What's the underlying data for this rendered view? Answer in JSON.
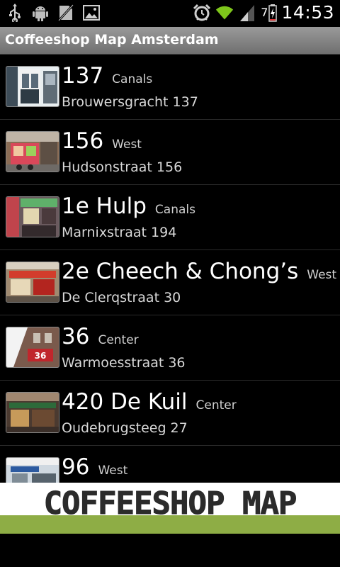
{
  "status_bar": {
    "time": "14:53",
    "battery_level": "7",
    "icons_left": [
      "usb-icon",
      "android-debug-icon",
      "no-sdcard-icon",
      "gallery-icon"
    ],
    "icons_right": [
      "alarm-icon",
      "wifi-icon",
      "signal-icon",
      "battery-charging-icon"
    ]
  },
  "app": {
    "title": "Coffeeshop Map Amsterdam"
  },
  "shops": [
    {
      "name": "137",
      "area": "Canals",
      "address": "Brouwersgracht 137"
    },
    {
      "name": "156",
      "area": "West",
      "address": "Hudsonstraat 156"
    },
    {
      "name": "1e Hulp",
      "area": "Canals",
      "address": "Marnixstraat 194"
    },
    {
      "name": "2e Cheech & Chong’s",
      "area": "West",
      "address": "De Clerqstraat 30"
    },
    {
      "name": "36",
      "area": "Center",
      "address": "Warmoesstraat 36"
    },
    {
      "name": "420 De Kuil",
      "area": "Center",
      "address": "Oudebrugsteeg 27"
    },
    {
      "name": "96",
      "area": "West",
      "address": ""
    }
  ],
  "banner": {
    "text": "COFFEESHOP MAP",
    "colors": {
      "top": "#ffffff",
      "bottom": "#8ead45",
      "text": "#2b2b2b"
    }
  }
}
